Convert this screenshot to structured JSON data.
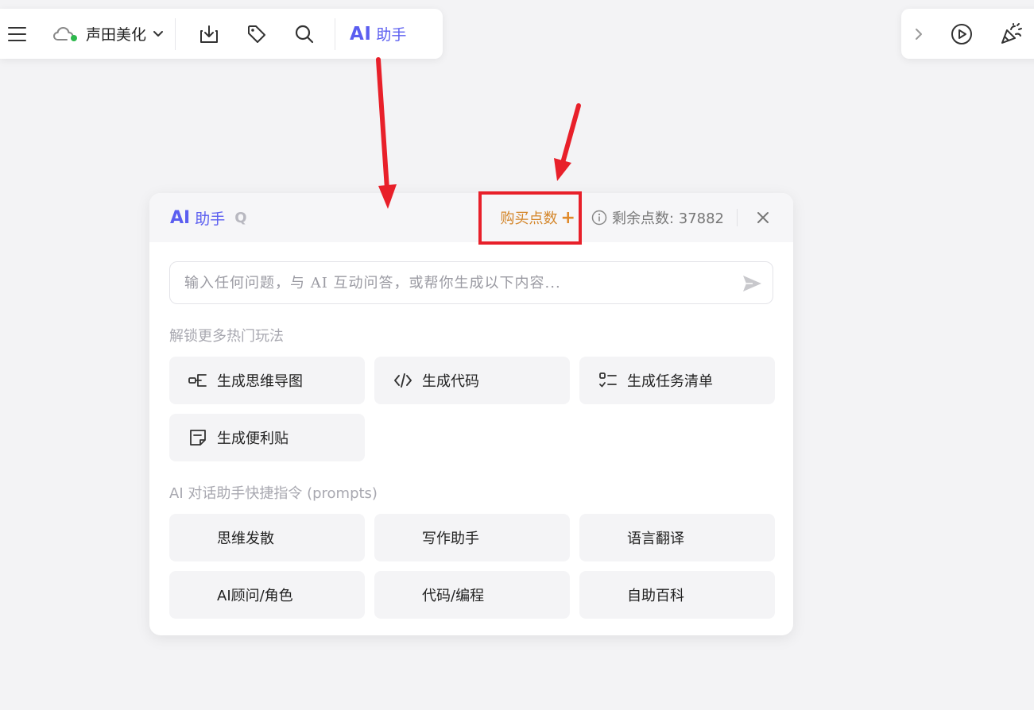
{
  "toolbar": {
    "doc_title": "声田美化",
    "ai_badge": "AI",
    "ai_label": "助手"
  },
  "panel": {
    "ai_badge": "AI",
    "title": "助手",
    "shortcut": "Q",
    "buy_points": "购买点数",
    "buy_plus": "+",
    "remaining": "剩余点数: 37882",
    "input_placeholder": "输入任何问题，与 AI 互动问答，或帮你生成以下内容...",
    "section1_title": "解锁更多热门玩法",
    "features": [
      {
        "label": "生成思维导图",
        "icon": "mindmap-icon"
      },
      {
        "label": "生成代码",
        "icon": "code-icon"
      },
      {
        "label": "生成任务清单",
        "icon": "checklist-icon"
      },
      {
        "label": "生成便利贴",
        "icon": "sticky-note-icon"
      }
    ],
    "section2_title": "AI 对话助手快捷指令 (prompts)",
    "prompts": [
      {
        "label": "思维发散"
      },
      {
        "label": "写作助手"
      },
      {
        "label": "语言翻译"
      },
      {
        "label": "AI顾问/角色"
      },
      {
        "label": "代码/编程"
      },
      {
        "label": "自助百科"
      }
    ]
  },
  "colors": {
    "accent": "#5b5ef0",
    "buy": "#d4862a",
    "annotation": "#e8202a",
    "status_online": "#2db84c"
  }
}
